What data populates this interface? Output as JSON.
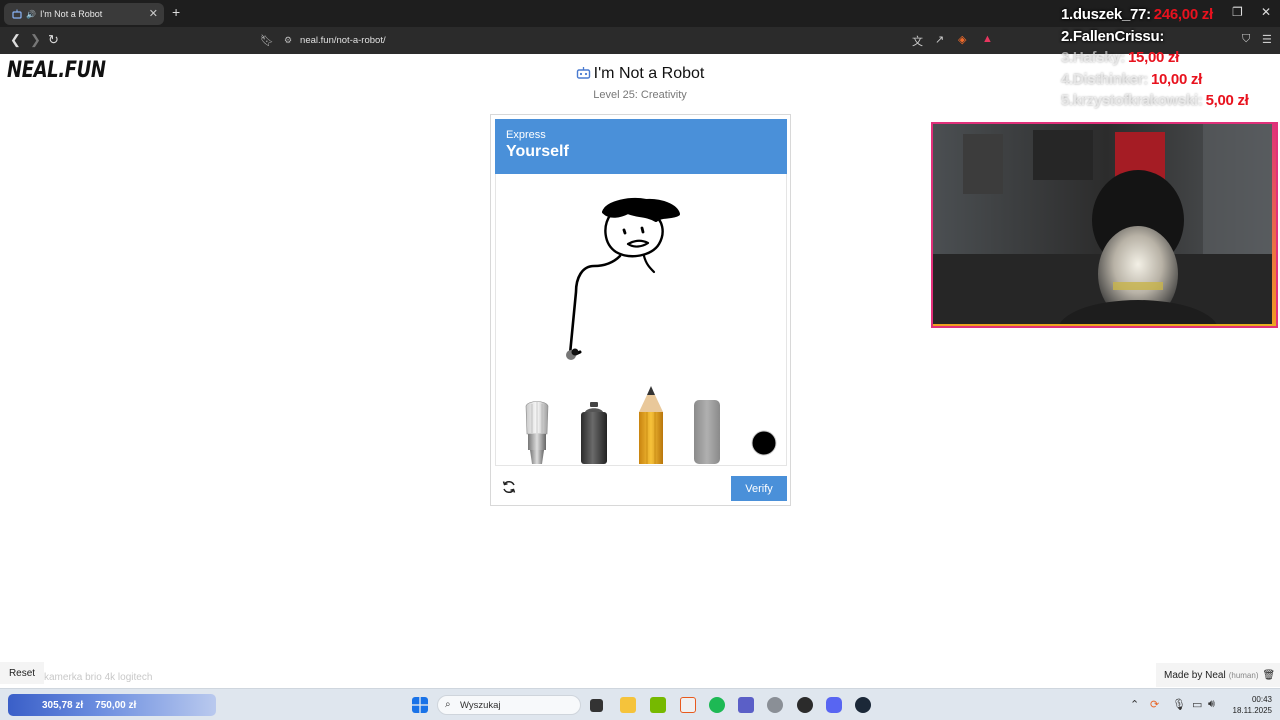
{
  "browser": {
    "tab_title": "I'm Not a Robot",
    "url": "neal.fun/not-a-robot/"
  },
  "page": {
    "logo": "NEAL.FUN",
    "title": "I'm Not a Robot",
    "subtitle": "Level 25: Creativity"
  },
  "captcha": {
    "header_small": "Express",
    "header_big": "Yourself",
    "tools": [
      "paint-brush",
      "spray-can",
      "pencil",
      "eraser",
      "color-black"
    ],
    "verify_label": "Verify",
    "accent_color": "#4a90d9"
  },
  "overlay": {
    "donors": [
      {
        "name": "1.duszek_77:",
        "amount": "246,00 zł"
      },
      {
        "name": "2.FallenCrissu:",
        "amount": ""
      },
      {
        "name": "3.Hafsky:",
        "amount": "15,00 zł"
      },
      {
        "name": "4.Disthinker:",
        "amount": "10,00 zł"
      },
      {
        "name": "5.krzystofkrakowski:",
        "amount": "5,00 zł"
      }
    ],
    "reset_label": "Reset",
    "cam_label": "kamerka brio 4k logitech",
    "made_by": "Made by Neal",
    "made_by_human": "(human)"
  },
  "taskbar": {
    "stock_1": "305,78 zł",
    "stock_2": "750,00 zł",
    "search_placeholder": "Wyszukaj",
    "time": "00:43",
    "date": "18.11.2025"
  }
}
